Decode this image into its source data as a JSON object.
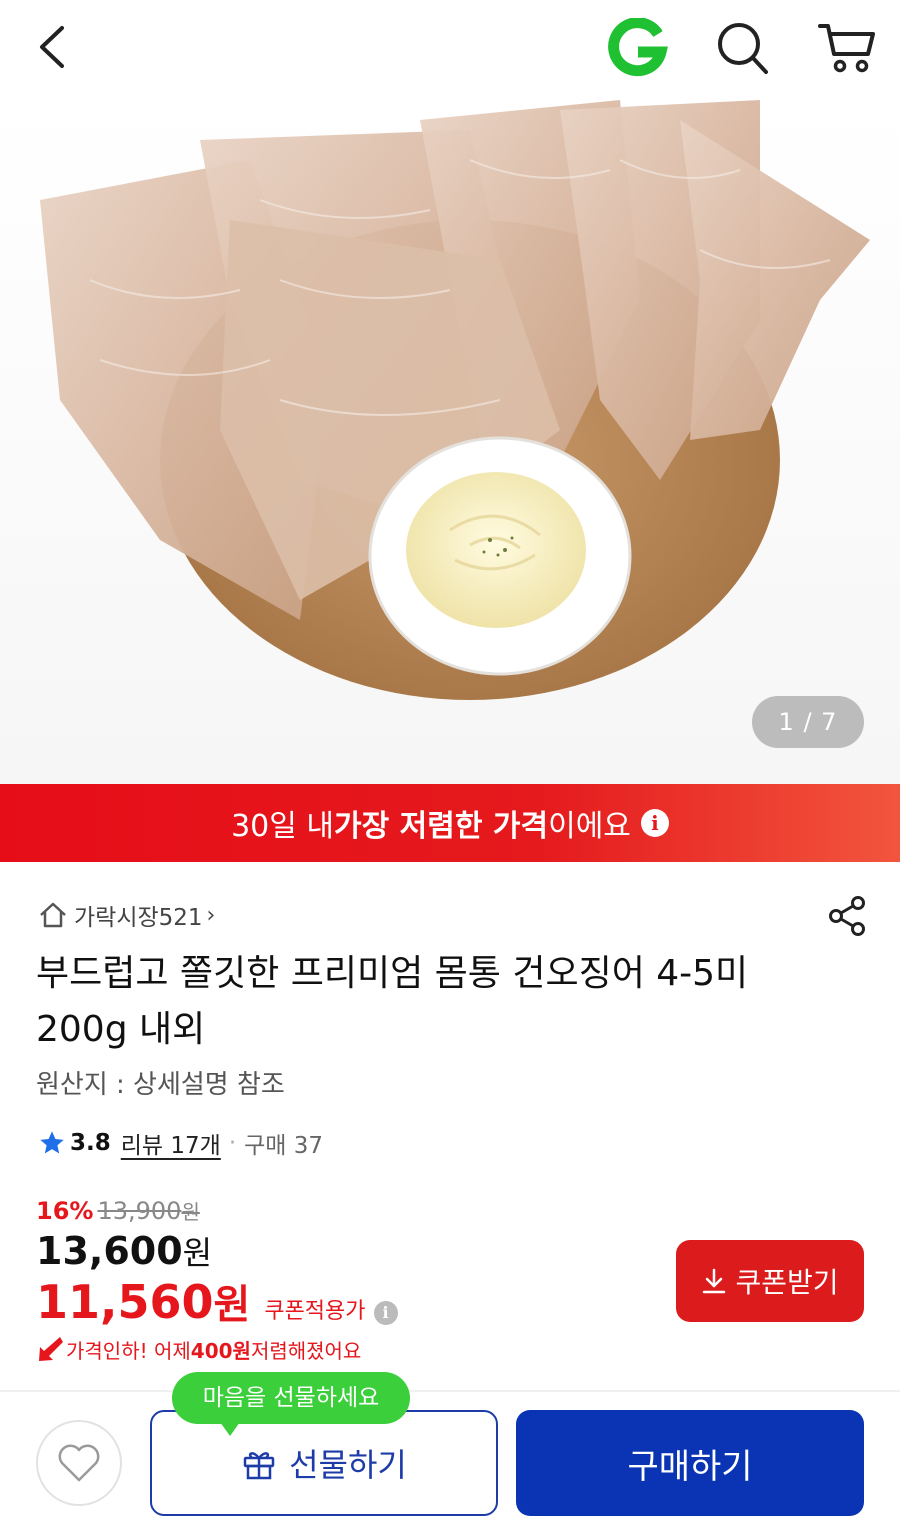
{
  "header": {
    "back_icon": "chevron-left-icon",
    "logo_letter": "G",
    "logo_color": "#20c033",
    "search_icon": "search-icon",
    "cart_icon": "cart-icon"
  },
  "hero": {
    "image": "dried-squid-on-wooden-board-with-mayo-dip",
    "pager": "1 / 7"
  },
  "banner": {
    "prefix": "30일 내 ",
    "highlight": "가장 저렴한 가격",
    "suffix": "이에요",
    "color": "#e60d18"
  },
  "store": {
    "icon": "home-icon",
    "name": "가락시장521",
    "chevron": "›"
  },
  "share_icon": "share-icon",
  "product": {
    "title": "부드럽고 쫄깃한 프리미엄 몸통 건오징어 4-5미 200g 내외",
    "origin": "원산지 : 상세설명 참조"
  },
  "rating": {
    "score": "3.8",
    "review": "리뷰 17개",
    "dot": "·",
    "purchase": "구매 37"
  },
  "price": {
    "discount_pct": "16%",
    "original": "13,900",
    "original_unit": "원",
    "sale": "13,600",
    "sale_unit": "원",
    "coupon": "11,560",
    "coupon_unit": "원",
    "coupon_label": "쿠폰적용가",
    "accent_color": "#e5171c"
  },
  "price_drop": {
    "prefix": "가격인하! 어제 ",
    "amount": "400원",
    "suffix": " 저렴해졌어요"
  },
  "coupon_button": "쿠폰받기",
  "bottom": {
    "tooltip": "마음을 선물하세요",
    "gift": "선물하기",
    "buy": "구매하기",
    "buy_color": "#0a34b4"
  }
}
